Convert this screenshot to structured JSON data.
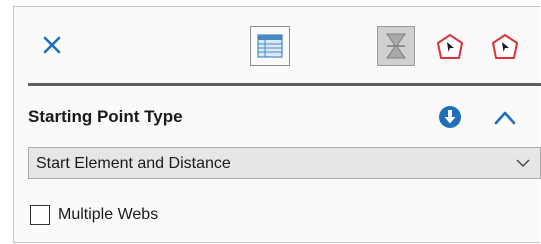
{
  "toolbar": {
    "close_icon": "close-icon",
    "table_icon": "table-view-icon",
    "filter_icon": "filter-icon",
    "point_red_icon": "pentagon-point-red-icon",
    "point_blue_icon": "pentagon-point-blue-icon"
  },
  "section": {
    "title": "Starting Point Type",
    "info_icon": "info-down-icon",
    "collapse_icon": "chevron-up-icon"
  },
  "dropdown": {
    "value": "Start Element and Distance",
    "arrow_icon": "chevron-down-icon"
  },
  "checkbox": {
    "label": "Multiple Webs",
    "checked": false
  },
  "colors": {
    "accent_blue": "#1e6fb5",
    "accent_red": "#d9343a"
  }
}
